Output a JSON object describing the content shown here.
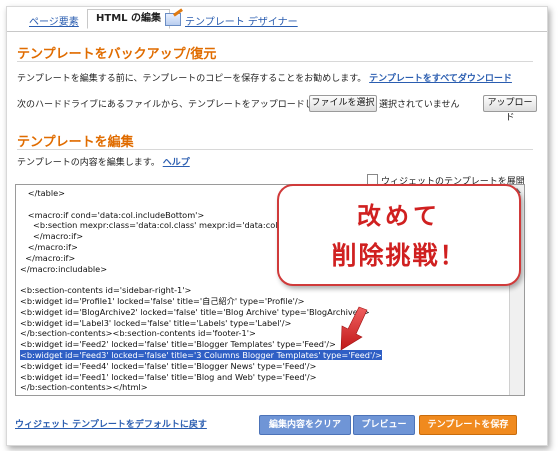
{
  "tabs": {
    "page_elements": "ページ要素",
    "html_edit": "HTML の編集",
    "template_designer": "テンプレート デザイナー"
  },
  "backup": {
    "title": "テンプレートをバックアップ/復元",
    "desc": "テンプレートを編集する前に、テンプレートのコピーを保存することをお勧めします。",
    "download_link": "テンプレートをすべてダウンロード",
    "upload_desc": "次のハードドライブにあるファイルから、テンプレートをアップロードします。",
    "choose_file": "ファイルを選択",
    "no_file": "選択されていません",
    "upload_button": "アップロード"
  },
  "edit": {
    "title": "テンプレートを編集",
    "desc": "テンプレートの内容を編集します。",
    "help_link": "ヘルプ",
    "expand_widgets": "ウィジェットのテンプレートを展開"
  },
  "code_lines": [
    "   </table>",
    "",
    "   <macro:if cond='data:col.includeBottom'>",
    "     <b:section mexpr:class='data:col.class' mexpr:id='data:col.id'",
    "     </macro:if>",
    "   </macro:if>",
    "  </macro:if>",
    "</macro:includable>",
    "",
    "<b:section-contents id='sidebar-right-1'>",
    "<b:widget id='Profile1' locked='false' title='自己紹介' type='Profile'/>",
    "<b:widget id='BlogArchive2' locked='false' title='Blog Archive' type='BlogArchive'/>",
    "<b:widget id='Label3' locked='false' title='Labels' type='Label'/>",
    "</b:section-contents><b:section-contents id='footer-1'>",
    "<b:widget id='Feed2' locked='false' title='Blogger Templates' type='Feed'/>",
    "<b:widget id='Feed3' locked='false' title='3 Columns Blogger Templates' type='Feed'/>",
    "<b:widget id='Feed4' locked='false' title='Blogger News' type='Feed'/>",
    "<b:widget id='Feed1' locked='false' title='Blog and Web' type='Feed'/>",
    "</b:section-contents></html>"
  ],
  "annotation": {
    "line1": "改めて",
    "line2": "削除挑戦！"
  },
  "footer": {
    "reset_link": "ウィジェット テンプレートをデフォルトに戻す",
    "clear_button": "編集内容をクリア",
    "preview_button": "プレビュー",
    "save_button": "テンプレートを保存"
  },
  "colors": {
    "accent_orange": "#e06c00",
    "link_blue": "#2a5db0",
    "highlight": "#2f5fc5",
    "annotation_red": "#d02020",
    "clear_btn": "#6f95d6",
    "save_btn": "#f08a1e"
  }
}
